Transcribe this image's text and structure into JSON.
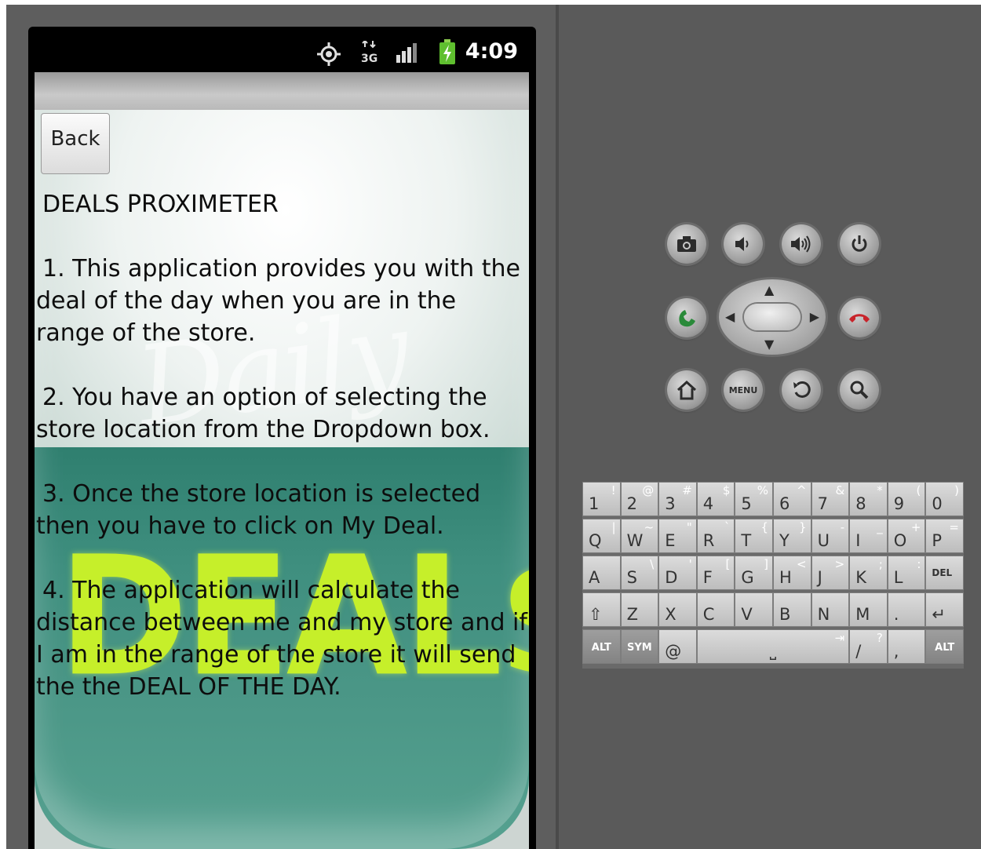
{
  "status_bar": {
    "time": "4:09",
    "icons": [
      "gps-icon",
      "3g-icon",
      "signal-icon",
      "battery-charging-icon"
    ]
  },
  "screen": {
    "back_label": "Back",
    "background_words": {
      "top": "Daily",
      "bottom": "DEAL$"
    },
    "title": "DEALS PROXIMETER",
    "paragraphs": [
      "1. This application provides you with the deal of the day when you are in the range of the store.",
      "2. You have an option of selecting the store location from the Dropdown box.",
      "3. Once the store location is selected then you have to click on My Deal.",
      "4. The application will calculate the distance between me and my store and if I am in the range of the store it will send the the DEAL OF THE DAY."
    ]
  },
  "controls": {
    "row1": [
      "camera-icon",
      "volume-down-icon",
      "volume-up-icon",
      "power-icon"
    ],
    "row3": [
      "home-icon",
      "MENU",
      "back-arrow-icon",
      "search-icon"
    ],
    "call": "call-icon",
    "end_call": "end-call-icon"
  },
  "keyboard": {
    "row1": [
      [
        "1",
        "!"
      ],
      [
        "2",
        "@"
      ],
      [
        "3",
        "#"
      ],
      [
        "4",
        "$"
      ],
      [
        "5",
        "%"
      ],
      [
        "6",
        "^"
      ],
      [
        "7",
        "&"
      ],
      [
        "8",
        "*"
      ],
      [
        "9",
        "("
      ],
      [
        "0",
        ")"
      ]
    ],
    "row2": [
      [
        "Q",
        "|"
      ],
      [
        "W",
        "~"
      ],
      [
        "E",
        "\""
      ],
      [
        "R",
        "`"
      ],
      [
        "T",
        "{"
      ],
      [
        "Y",
        "}"
      ],
      [
        "U",
        "-"
      ],
      [
        "I",
        "_"
      ],
      [
        "O",
        "+"
      ],
      [
        "P",
        "="
      ]
    ],
    "row3": [
      [
        "A",
        ""
      ],
      [
        "S",
        "\\"
      ],
      [
        "D",
        "'"
      ],
      [
        "F",
        "["
      ],
      [
        "G",
        "]"
      ],
      [
        "H",
        "<"
      ],
      [
        "J",
        ">"
      ],
      [
        "K",
        ";"
      ],
      [
        "L",
        ":"
      ],
      [
        "DEL",
        ""
      ]
    ],
    "row4": [
      [
        "⇧",
        ""
      ],
      [
        "Z",
        ""
      ],
      [
        "X",
        ""
      ],
      [
        "C",
        ""
      ],
      [
        "V",
        ""
      ],
      [
        "B",
        ""
      ],
      [
        "N",
        ""
      ],
      [
        "M",
        ""
      ],
      [
        ".",
        ""
      ],
      [
        "↵",
        ""
      ]
    ],
    "row5": {
      "alt_left": "ALT",
      "sym": "SYM",
      "at": "@",
      "space": "⎵",
      "tab": "⇥",
      "slash": "/",
      "question": "?",
      "comma": ",",
      "alt_right": "ALT"
    }
  }
}
